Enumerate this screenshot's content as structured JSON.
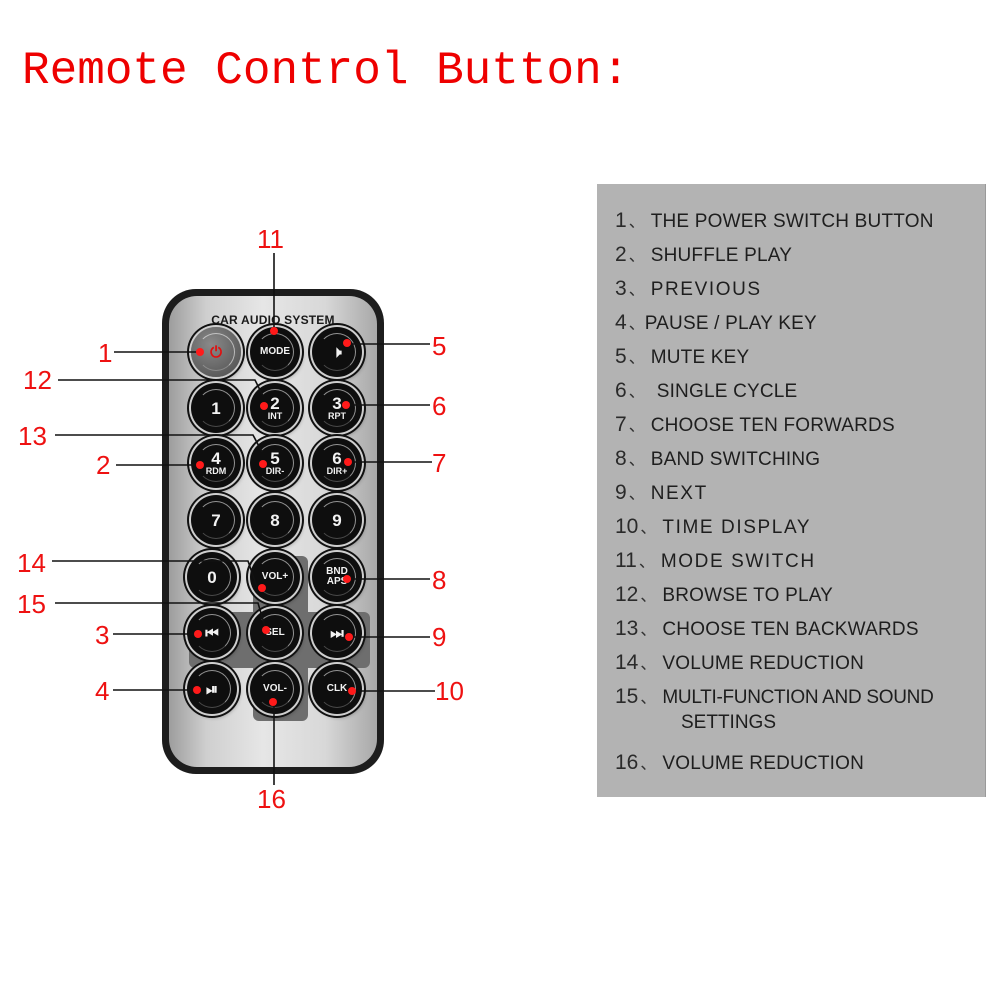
{
  "title": "Remote Control Button:",
  "remote": {
    "brand": "CAR AUDIO SYSTEM",
    "buttons": [
      {
        "id": "power",
        "icon": "power-icon",
        "glyph": "⏻"
      },
      {
        "id": "mode",
        "label": "MODE"
      },
      {
        "id": "mute",
        "icon": "mute-icon",
        "glyph": "🕨"
      },
      {
        "id": "1",
        "label": "1"
      },
      {
        "id": "2",
        "label": "2",
        "sub": "INT"
      },
      {
        "id": "3",
        "label": "3",
        "sub": "RPT"
      },
      {
        "id": "4",
        "label": "4",
        "sub": "RDM"
      },
      {
        "id": "5",
        "label": "5",
        "sub": "DIR-"
      },
      {
        "id": "6",
        "label": "6",
        "sub": "DIR+"
      },
      {
        "id": "7",
        "label": "7"
      },
      {
        "id": "8",
        "label": "8"
      },
      {
        "id": "9",
        "label": "9"
      },
      {
        "id": "0",
        "label": "0"
      },
      {
        "id": "volup",
        "label": "VOL+"
      },
      {
        "id": "bnd",
        "label": "BND",
        "sub": "APS"
      },
      {
        "id": "prev",
        "icon": "previous-icon",
        "glyph": "⏮"
      },
      {
        "id": "sel",
        "label": "SEL"
      },
      {
        "id": "next",
        "icon": "next-icon",
        "glyph": "⏭"
      },
      {
        "id": "playpause",
        "icon": "play-pause-icon",
        "glyph": "⏯"
      },
      {
        "id": "voldown",
        "label": "VOL-"
      },
      {
        "id": "clk",
        "label": "CLK"
      }
    ]
  },
  "callouts": [
    "1",
    "2",
    "3",
    "4",
    "5",
    "6",
    "7",
    "8",
    "9",
    "10",
    "11",
    "12",
    "13",
    "14",
    "15",
    "16"
  ],
  "legend": {
    "separator": "、",
    "items": [
      {
        "num": "1",
        "text": "THE POWER SWITCH BUTTON"
      },
      {
        "num": "2",
        "text": "SHUFFLE PLAY"
      },
      {
        "num": "3",
        "text": "PREVIOUS"
      },
      {
        "num": "4",
        "text": "PAUSE / PLAY KEY"
      },
      {
        "num": "5",
        "text": "MUTE KEY"
      },
      {
        "num": "6",
        "text": "SINGLE CYCLE"
      },
      {
        "num": "7",
        "text": "CHOOSE TEN FORWARDS"
      },
      {
        "num": "8",
        "text": "BAND SWITCHING"
      },
      {
        "num": "9",
        "text": "NEXT"
      },
      {
        "num": "10",
        "text": "TIME DISPLAY"
      },
      {
        "num": "11",
        "text": "MODE SWITCH"
      },
      {
        "num": "12",
        "text": "BROWSE TO PLAY"
      },
      {
        "num": "13",
        "text": "CHOOSE TEN BACKWARDS"
      },
      {
        "num": "14",
        "text": "VOLUME REDUCTION"
      },
      {
        "num": "15",
        "text": "MULTI-FUNCTION AND SOUND",
        "cont": "SETTINGS"
      },
      {
        "num": "16",
        "text": "VOLUME REDUCTION"
      }
    ]
  },
  "colors": {
    "title": "#ee0000",
    "callout": "#ee1111",
    "marker": "#ff1a1a",
    "legend_bg": "#b3b3b3"
  }
}
